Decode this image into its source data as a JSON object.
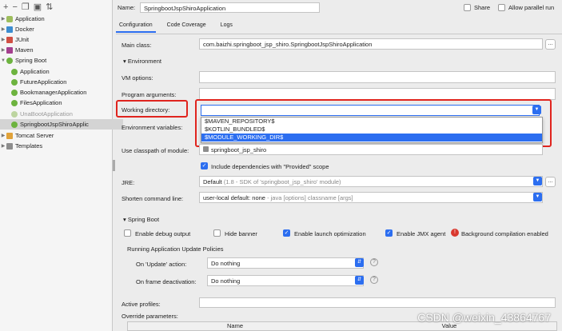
{
  "toolbar": {
    "add": "+",
    "remove": "−",
    "copy": "❐",
    "folder": "▣",
    "sort": "⇅"
  },
  "tree": [
    {
      "label": "Application",
      "icon": "application-icon"
    },
    {
      "label": "Docker",
      "icon": "docker-icon"
    },
    {
      "label": "JUnit",
      "icon": "junit-icon"
    },
    {
      "label": "Maven",
      "icon": "maven-icon"
    },
    {
      "label": "Spring Boot",
      "icon": "spring-boot-icon"
    },
    {
      "label": "Application",
      "icon": "spring-app-icon"
    },
    {
      "label": "FutureApplication",
      "icon": "spring-app-icon"
    },
    {
      "label": "BookmanagerApplication",
      "icon": "spring-app-icon"
    },
    {
      "label": "FilesApplication",
      "icon": "spring-app-icon"
    },
    {
      "label": "UnaBootApplication",
      "icon": "spring-app-disabled-icon"
    },
    {
      "label": "SpringbootJspShiroApplic",
      "icon": "spring-app-icon"
    },
    {
      "label": "Tomcat Server",
      "icon": "tomcat-icon"
    },
    {
      "label": "Templates",
      "icon": "templates-icon"
    }
  ],
  "header": {
    "name_label": "Name:",
    "name_value": "SpringbootJspShiroApplication",
    "share_label": "Share",
    "parallel_label": "Allow parallel run"
  },
  "tabs": [
    "Configuration",
    "Code Coverage",
    "Logs"
  ],
  "main_class": {
    "label": "Main class:",
    "value": "com.baizhi.springboot_jsp_shiro.SpringbootJspShiroApplication"
  },
  "environment_section": "Environment",
  "vm_options_label": "VM options:",
  "program_args_label": "Program arguments:",
  "working_dir_label": "Working directory:",
  "working_dir_value": "",
  "dropdown_items": [
    "$MAVEN_REPOSITORY$",
    "$KOTLIN_BUNDLED$",
    "$MODULE_WORKING_DIR$"
  ],
  "env_vars_label": "Environment variables:",
  "classpath": {
    "label": "Use classpath of module:",
    "value": "springboot_jsp_shiro"
  },
  "include_provided": "Include dependencies with \"Provided\" scope",
  "jre": {
    "label": "JRE:",
    "value": "Default",
    "hint": "(1.8 - SDK of 'springboot_jsp_shiro' module)"
  },
  "shorten": {
    "label": "Shorten command line:",
    "value": "user-local default: none",
    "hint": "- java [options] classname [args]"
  },
  "spring_boot_section": "Spring Boot",
  "debug_output": "Enable debug output",
  "hide_banner": "Hide banner",
  "launch_opt": "Enable launch optimization",
  "jmx_agent": "Enable JMX agent",
  "bg_compile": "Background compilation enabled",
  "update_policies": "Running Application Update Policies",
  "on_update_label": "On 'Update' action:",
  "on_update_value": "Do nothing",
  "on_frame_label": "On frame deactivation:",
  "on_frame_value": "Do nothing",
  "active_profiles_label": "Active profiles:",
  "override_params_label": "Override parameters:",
  "table_headers": [
    "Name",
    "Value"
  ],
  "watermark": "CSDN @weixin_43864767",
  "colors": {
    "accent": "#2c6ef0",
    "highlight_red": "#e0241e"
  }
}
